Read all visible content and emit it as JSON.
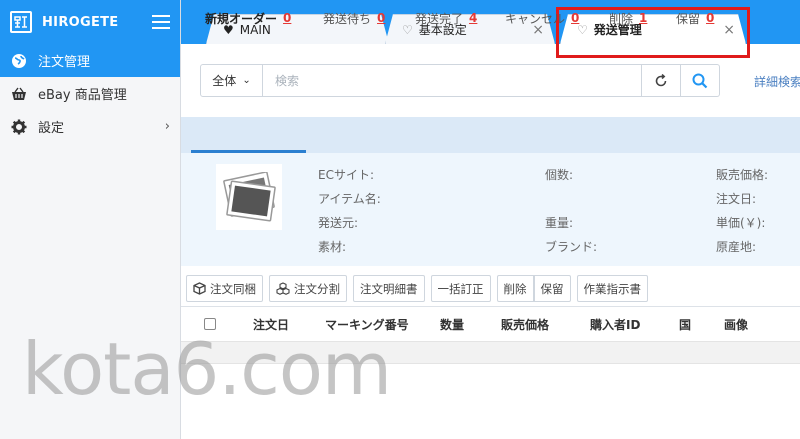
{
  "app": {
    "name": "HIROGETE",
    "logo_text": "弘\n下"
  },
  "colors": {
    "accent": "#2196f3",
    "highlight": "#e01b1b",
    "count": "#e53935",
    "link": "#4a7fc1"
  },
  "sidebar": {
    "items": [
      {
        "label": "注文管理",
        "icon": "globe-icon",
        "active": true
      },
      {
        "label": "eBay 商品管理",
        "icon": "basket-icon",
        "active": false
      },
      {
        "label": "設定",
        "icon": "gear-icon",
        "active": false,
        "chevron": "›"
      }
    ]
  },
  "tabs": [
    {
      "label": "MAIN",
      "icon": "heart-filled-icon",
      "closable": false
    },
    {
      "label": "基本設定",
      "icon": "heart-outline-icon",
      "closable": true
    },
    {
      "label": "発送管理",
      "icon": "heart-outline-icon",
      "closable": true,
      "active": true
    }
  ],
  "search": {
    "scope": "全体",
    "placeholder": "検索",
    "advanced_link": "詳細検索"
  },
  "status_tabs": [
    {
      "label": "新規オーダー",
      "count": "0"
    },
    {
      "label": "発送待ち",
      "count": "0"
    },
    {
      "label": "発送完了",
      "count": "4"
    },
    {
      "label": "キャンセル",
      "count": "0"
    },
    {
      "label": "削除",
      "count": "1"
    },
    {
      "label": "保留",
      "count": "0"
    }
  ],
  "detail": {
    "col1": [
      "ECサイト:",
      "アイテム名:",
      "発送元:",
      "素材:"
    ],
    "col2": [
      "個数:",
      "重量:",
      "ブランド:"
    ],
    "col3": [
      "販売価格:",
      "注文日:",
      "単価(￥):",
      "原産地:"
    ]
  },
  "toolbar": {
    "buttons": [
      "注文同梱",
      "注文分割",
      "注文明細書",
      "一括訂正",
      "削除",
      "保留",
      "作業指示書"
    ]
  },
  "table": {
    "headers": [
      "注文日",
      "マーキング番号",
      "数量",
      "販売価格",
      "購入者ID",
      "国",
      "画像"
    ]
  },
  "watermark": "kota6.com"
}
